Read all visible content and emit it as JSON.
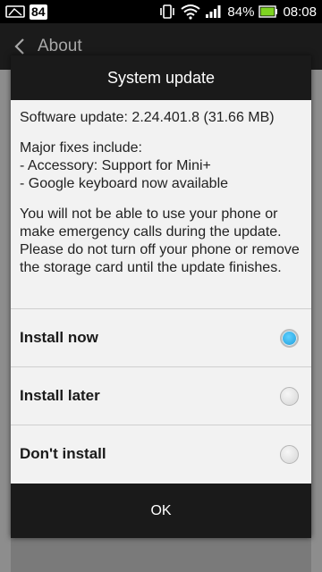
{
  "statusbar": {
    "badge": "84",
    "battery_percent": "84%",
    "time": "08:08",
    "icons": [
      "screenshot-icon",
      "vibrate-icon",
      "wifi-icon",
      "signal-icon",
      "battery-icon"
    ]
  },
  "actionbar": {
    "title": "About"
  },
  "dialog": {
    "title": "System update",
    "software_update": "Software update: 2.24.401.8 (31.66 MB)",
    "fixes_heading": "Major fixes include:",
    "fix_1": "- Accessory: Support for Mini+",
    "fix_2": "- Google keyboard now available",
    "warning": "You will not be able to use your phone or make emergency calls during the update. Please do not turn off your phone or remove the storage card until the update finishes.",
    "options": [
      {
        "label": "Install now",
        "selected": true
      },
      {
        "label": "Install later",
        "selected": false
      },
      {
        "label": "Don't install",
        "selected": false
      }
    ],
    "ok_label": "OK"
  },
  "colors": {
    "accent": "#33b5e5",
    "dialog_bg": "#f2f2f2",
    "title_bg": "#1a1a1a"
  }
}
